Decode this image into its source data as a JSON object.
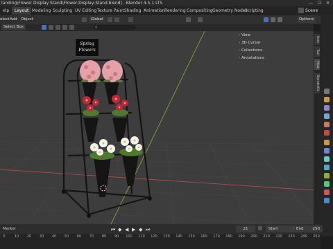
{
  "window": {
    "title": "landing\\Flower Display Stand\\Flower-Display-Stand.blend] - Blender 4.5.1 LTS"
  },
  "topbar": {
    "app_menu": "elp",
    "tabs": [
      "Layout",
      "Modeling",
      "Sculpting",
      "UV Editing",
      "Texture Paint",
      "Shading",
      "Animation",
      "Rendering",
      "Compositing",
      "Geometry Nodes",
      "Scripting"
    ],
    "active_tab": "Layout",
    "scene_label": "Scene"
  },
  "header": {
    "menus": [
      "elect",
      "Add",
      "Object"
    ],
    "transform": "Global",
    "options": "Options"
  },
  "viewport_header": {
    "select_mode": "Select Box",
    "search_placeholder": ""
  },
  "npanel": {
    "items": [
      "View",
      "3D Cursor",
      "Collections",
      "Annotations"
    ],
    "tabs": [
      "Item",
      "Tool",
      "View",
      "BlenderKit"
    ]
  },
  "sign": {
    "line1": "Spring",
    "line2": "Flowers"
  },
  "timeline": {
    "label": "Marker",
    "current_frame": "21",
    "start_label": "Start",
    "start_value": "1",
    "end_label": "End",
    "end_value": "250",
    "ticks": [
      "0",
      "10",
      "20",
      "30",
      "40",
      "50",
      "60",
      "70",
      "80",
      "90",
      "100",
      "110",
      "120",
      "130",
      "140",
      "150",
      "160",
      "170",
      "180",
      "190",
      "200",
      "210",
      "220",
      "230",
      "240",
      "250"
    ]
  },
  "colors": {
    "accent": "#4772b3",
    "x_axis": "#c44a4a",
    "y_axis": "#8bb03a",
    "flower_pink": "#e6a1a8",
    "flower_red": "#c0273b",
    "flower_white": "#f2f2ee"
  }
}
